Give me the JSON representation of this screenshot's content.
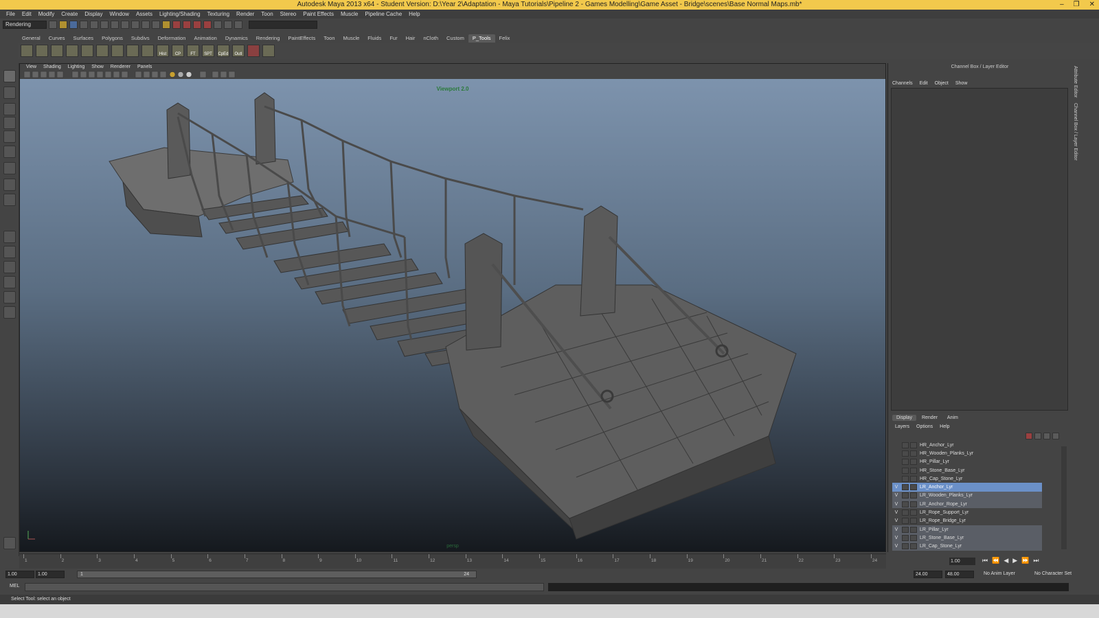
{
  "window": {
    "title": "Autodesk Maya 2013 x64 - Student Version: D:\\Year 2\\Adaptation - Maya Tutorials\\Pipeline 2 - Games Modelling\\Game Asset - Bridge\\scenes\\Base Normal Maps.mb*",
    "controls": [
      "–",
      "❐",
      "✕"
    ]
  },
  "menubar": [
    "File",
    "Edit",
    "Modify",
    "Create",
    "Display",
    "Window",
    "Assets",
    "Lighting/Shading",
    "Texturing",
    "Render",
    "Toon",
    "Stereo",
    "Paint Effects",
    "Muscle",
    "Pipeline Cache",
    "Help"
  ],
  "statusline": {
    "mode": "Rendering"
  },
  "shelf": {
    "tabs": [
      "General",
      "Curves",
      "Surfaces",
      "Polygons",
      "Subdivs",
      "Deformation",
      "Animation",
      "Dynamics",
      "Rendering",
      "PaintEffects",
      "Toon",
      "Muscle",
      "Fluids",
      "Fur",
      "Hair",
      "nCloth",
      "Custom",
      "P_Tools",
      "Felix"
    ],
    "active_tab": "P_Tools",
    "labeled_icons": [
      "Hist",
      "CP",
      "FT",
      "SPT",
      "CpEd",
      "Outl"
    ]
  },
  "viewport": {
    "menu": [
      "View",
      "Shading",
      "Lighting",
      "Show",
      "Renderer",
      "Panels"
    ],
    "renderer_label": "Viewport 2.0",
    "camera_label": "persp"
  },
  "channel_box": {
    "title": "Channel Box / Layer Editor",
    "menu": [
      "Channels",
      "Edit",
      "Object",
      "Show"
    ]
  },
  "layer_editor": {
    "tabs": [
      "Display",
      "Render",
      "Anim"
    ],
    "active_tab": "Display",
    "menu": [
      "Layers",
      "Options",
      "Help"
    ],
    "layers": [
      {
        "name": "HR_Anchor_Lyr",
        "visible": "",
        "group": "hr"
      },
      {
        "name": "HR_Wooden_Planks_Lyr",
        "visible": "",
        "group": "hr"
      },
      {
        "name": "HR_Pillar_Lyr",
        "visible": "",
        "group": "hr"
      },
      {
        "name": "HR_Stone_Base_Lyr",
        "visible": "",
        "group": "hr"
      },
      {
        "name": "HR_Cap_Stone_Lyr",
        "visible": "",
        "group": "hr"
      },
      {
        "name": "LR_Anchor_Lyr",
        "visible": "V",
        "group": "sel"
      },
      {
        "name": "LR_Wooden_Planks_Lyr",
        "visible": "V",
        "group": "lr"
      },
      {
        "name": "LR_Anchor_Rope_Lyr",
        "visible": "V",
        "group": "lr"
      },
      {
        "name": "LR_Rope_Support_Lyr",
        "visible": "V",
        "group": "hr"
      },
      {
        "name": "LR_Rope_Bridge_Lyr",
        "visible": "V",
        "group": "hr"
      },
      {
        "name": "LR_Pillar_Lyr",
        "visible": "V",
        "group": "lr"
      },
      {
        "name": "LR_Stone_Base_Lyr",
        "visible": "V",
        "group": "lr"
      },
      {
        "name": "LR_Cap_Stone_Lyr",
        "visible": "V",
        "group": "lr"
      }
    ]
  },
  "side_tabs": [
    "Attribute Editor",
    "Channel Box / Layer Editor"
  ],
  "time_slider": {
    "ticks": [
      "1",
      "2",
      "3",
      "4",
      "5",
      "6",
      "7",
      "8",
      "9",
      "10",
      "11",
      "12",
      "13",
      "14",
      "15",
      "16",
      "17",
      "18",
      "19",
      "20",
      "21",
      "22",
      "23",
      "24"
    ],
    "current_frame": "1.00"
  },
  "range_slider": {
    "start_time": "1.00",
    "playback_start": "1.00",
    "range_start_label": "1",
    "range_end_label": "24",
    "playback_end": "24.00",
    "end_time": "48.00",
    "anim_layer": "No Anim Layer",
    "character_set": "No Character Set"
  },
  "command_line": {
    "label": "MEL"
  },
  "help_line": {
    "text": "Select Tool: select an object"
  }
}
